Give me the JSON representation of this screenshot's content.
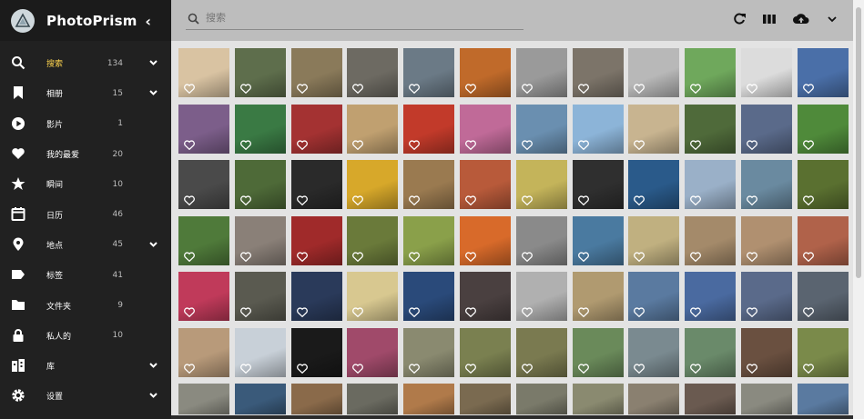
{
  "app": {
    "title": "PhotoPrism"
  },
  "search": {
    "placeholder": "搜索"
  },
  "sidebar": {
    "items": [
      {
        "icon": "search-icon",
        "label": "搜索",
        "count": "134",
        "expandable": true,
        "active": true
      },
      {
        "icon": "bookmark-icon",
        "label": "相册",
        "count": "15",
        "expandable": true
      },
      {
        "icon": "play-icon",
        "label": "影片",
        "count": "1",
        "expandable": false
      },
      {
        "icon": "heart-icon",
        "label": "我的最爱",
        "count": "20",
        "expandable": false
      },
      {
        "icon": "star-icon",
        "label": "瞬间",
        "count": "10",
        "expandable": false
      },
      {
        "icon": "calendar-icon",
        "label": "日历",
        "count": "46",
        "expandable": false
      },
      {
        "icon": "location-pin-icon",
        "label": "地点",
        "count": "45",
        "expandable": true
      },
      {
        "icon": "label-tag-icon",
        "label": "标签",
        "count": "41",
        "expandable": false
      },
      {
        "icon": "folder-icon",
        "label": "文件夹",
        "count": "9",
        "expandable": false
      },
      {
        "icon": "lock-icon",
        "label": "私人的",
        "count": "10",
        "expandable": false
      },
      {
        "icon": "library-icon",
        "label": "库",
        "count": "",
        "expandable": true
      },
      {
        "icon": "gear-icon",
        "label": "设置",
        "count": "",
        "expandable": true
      }
    ]
  },
  "toolbar": {
    "icons": [
      "refresh-icon",
      "view-toggle-icon",
      "upload-icon",
      "chevron-down-icon"
    ]
  },
  "colors": {
    "sidebar": "#212121",
    "topbar": "#bdbdbd",
    "background": "#e3e3e3",
    "label": "#ffd54f"
  },
  "photos": [
    "#d9c3a2",
    "#5e6e4c",
    "#8a7a5a",
    "#6d6a62",
    "#6b7a86",
    "#c06a2a",
    "#9a9a9a",
    "#7c7469",
    "#b8b8b8",
    "#6fa85c",
    "#dcdcdc",
    "#4a6fa8",
    "#7c5e8a",
    "#3a7a44",
    "#a43232",
    "#c0a070",
    "#c23a2a",
    "#c06a98",
    "#6a8fb0",
    "#8cb4d8",
    "#c8b490",
    "#4f6a3a",
    "#5a6a8a",
    "#4f8a3a",
    "#4a4a4a",
    "#4e6a38",
    "#2a2a2a",
    "#d7a82a",
    "#9a7a50",
    "#b85a3a",
    "#c4b45a",
    "#2f2f2f",
    "#2a5a8a",
    "#9ab0c8",
    "#6a8aa0",
    "#5a7030",
    "#4f7a3a",
    "#8a8078",
    "#a02a2a",
    "#6a7a3a",
    "#8aa04a",
    "#d86a2a",
    "#8a8a8a",
    "#4a7aa0",
    "#c0b080",
    "#a48a6a",
    "#b09070",
    "#b0624a",
    "#c03a5a",
    "#5a5a50",
    "#2a3a5a",
    "#d8c890",
    "#2a4a7a",
    "#4a4040",
    "#b0b0b0",
    "#b09a70",
    "#5a7aa0",
    "#4a6aa0",
    "#5a6a8a",
    "#5a6470",
    "#b89a7a",
    "#c8d0d8",
    "#1a1a1a",
    "#a04a6a",
    "#8a8a70",
    "#7a8050",
    "#7a7a50",
    "#6a8a5a",
    "#7a8a90",
    "#6a8a6a",
    "#6a5040",
    "#7a8a4a",
    "#8a8a80",
    "#3a5a7a",
    "#8a6a4a",
    "#6a6a60",
    "#b07a4a",
    "#7a6a50",
    "#7a7a6a",
    "#8a8a70",
    "#8a8070",
    "#6a5a50",
    "#8a8a80",
    "#5a7aa0"
  ]
}
